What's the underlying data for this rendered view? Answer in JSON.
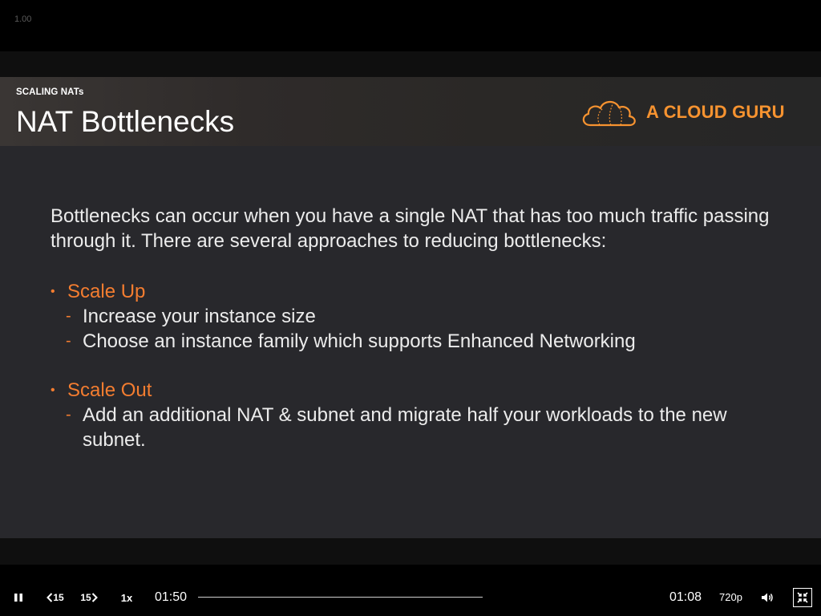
{
  "player": {
    "zoom_readout": "1.00",
    "elapsed": "01:50",
    "remaining": "01:08",
    "speed": "1x",
    "quality": "720p",
    "skip_back_label": "15",
    "skip_forward_label": "15",
    "progress_fraction": 0.0,
    "icons": {
      "pause": "pause-icon",
      "rewind": "rewind-15-icon",
      "forward": "forward-15-icon",
      "volume": "volume-icon",
      "exit_fullscreen": "exit-fullscreen-icon"
    }
  },
  "slide": {
    "kicker": "SCALING NATs",
    "title": "NAT Bottlenecks",
    "logo_text": "A CLOUD GURU",
    "intro": "Bottlenecks can occur when you have a single NAT that has too much traffic passing through it. There are several approaches to reducing bottlenecks:",
    "sections": [
      {
        "heading": "Scale Up",
        "items": [
          "Increase your instance size",
          "Choose an instance family which supports Enhanced Networking"
        ]
      },
      {
        "heading": "Scale Out",
        "items": [
          "Add an additional NAT & subnet and migrate half your workloads to the new subnet."
        ]
      }
    ],
    "colors": {
      "accent": "#f47d30",
      "logo": "#f79330",
      "background": "#28282c",
      "text": "#ececec"
    }
  }
}
